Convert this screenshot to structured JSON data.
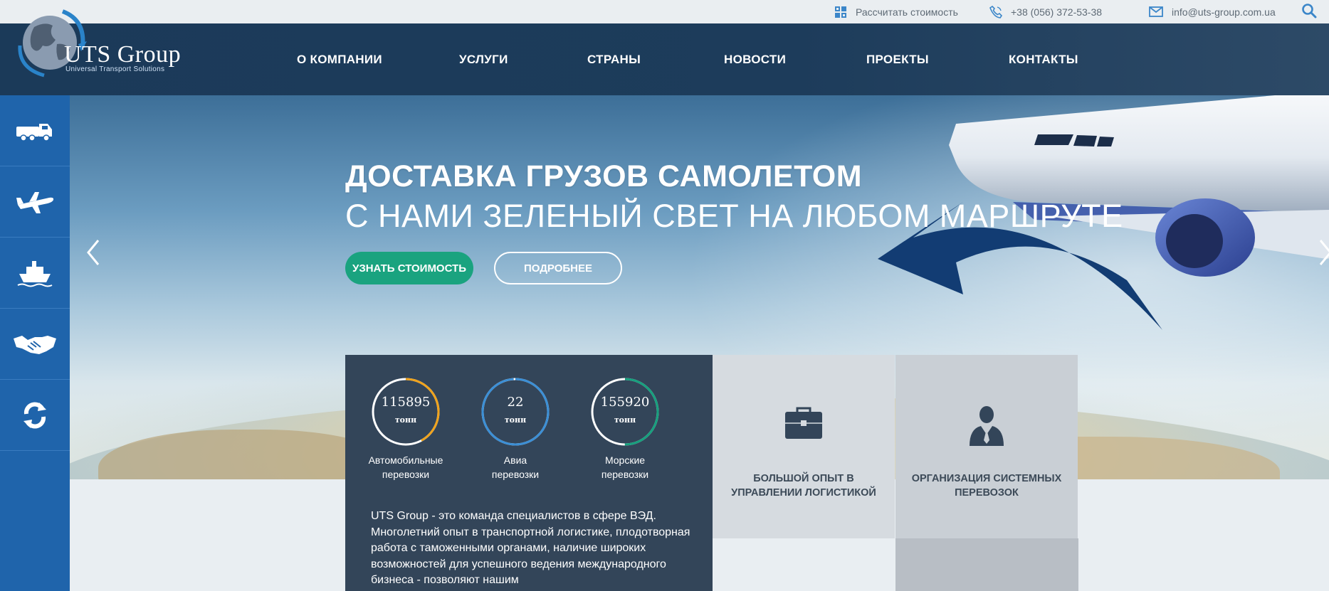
{
  "topbar": {
    "calc_label": "Рассчитать стоимость",
    "phone": "+38 (056) 372-53-38",
    "email": "info@uts-group.com.ua",
    "icons": [
      "calculator-grid-icon",
      "phone-icon",
      "mail-icon",
      "search-icon"
    ],
    "accent": "#3b86c9"
  },
  "logo": {
    "title": "UTS Group",
    "subtitle": "Universal Transport Solutions"
  },
  "nav": {
    "items": [
      {
        "label": "О КОМПАНИИ"
      },
      {
        "label": "УСЛУГИ"
      },
      {
        "label": "СТРАНЫ"
      },
      {
        "label": "НОВОСТИ"
      },
      {
        "label": "ПРОЕКТЫ"
      },
      {
        "label": "КОНТАКТЫ"
      }
    ]
  },
  "sidebar": {
    "items": [
      {
        "icon": "truck-icon"
      },
      {
        "icon": "airplane-icon"
      },
      {
        "icon": "ship-icon"
      },
      {
        "icon": "handshake-icon"
      },
      {
        "icon": "refresh-icon"
      }
    ],
    "color": "#1f64ab"
  },
  "hero": {
    "title": "ДОСТАВКА ГРУЗОВ САМОЛЕТОМ",
    "subtitle": "С НАМИ ЗЕЛЕНЫЙ СВЕТ НА ЛЮБОМ МАРШРУТЕ",
    "primary_button": "УЗНАТЬ СТОИМОСТЬ",
    "secondary_button": "ПОДРОБНЕЕ",
    "primary_color": "#1aa37f"
  },
  "stats": {
    "items": [
      {
        "value": "115895",
        "unit": "тонн",
        "label_line1": "Автомобильные",
        "label_line2": "перевозки",
        "color": "#f0a31c",
        "progress": 0.42
      },
      {
        "value": "22",
        "unit": "тонн",
        "label_line1": "Авиа",
        "label_line2": "перевозки",
        "color": "#3b8fd6",
        "progress": 0.99
      },
      {
        "value": "155920",
        "unit": "тонн",
        "label_line1": "Морские",
        "label_line2": "перевозки",
        "color": "#17a07e",
        "progress": 0.5
      }
    ],
    "about": "UTS Group - это команда специалистов в сфере ВЭД. Многолетний опыт в транспортной логистике, плодотворная работа с таможенными органами, наличие широких возможностей для успешного ведения международного бизнеса - позволяют нашим"
  },
  "features": [
    {
      "label": "БОЛЬШОЙ ОПЫТ В УПРАВЛЕНИИ ЛОГИСТИКОЙ",
      "icon": "briefcase-icon"
    },
    {
      "label": "ОРГАНИЗАЦИЯ СИСТЕМНЫХ ПЕРЕВОЗОК",
      "icon": "businessman-icon"
    }
  ]
}
